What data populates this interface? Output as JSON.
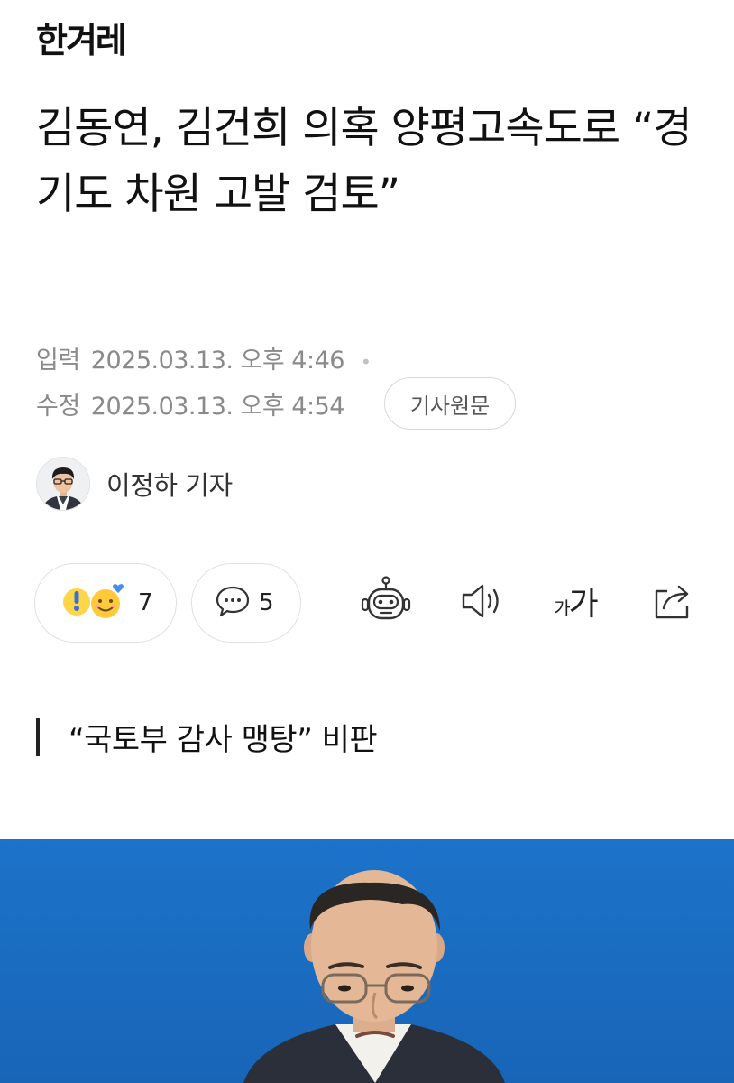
{
  "header": {
    "logo": "한겨레"
  },
  "article": {
    "title": "김동연, 김건희 의혹 양평고속도로 “경기도 차원 고발 검토”",
    "published_label": "입력",
    "published_at": "2025.03.13. 오후 4:46",
    "updated_label": "수정",
    "updated_at": "2025.03.13. 오후 4:54",
    "original_button": "기사원문",
    "reporter": "이정하 기자",
    "subheading": "“국토부 감사 맹탕” 비판"
  },
  "actions": {
    "reaction_count": "7",
    "comment_count": "5",
    "font_size_label_small": "가",
    "font_size_label_large": "가",
    "icons": [
      "thumbs-reaction-icon",
      "comment-icon",
      "ai-summary-robot-icon",
      "text-to-speech-icon",
      "font-size-icon",
      "share-icon"
    ]
  },
  "colors": {
    "photo_background": "#1a6fc4",
    "meta_text": "#8a8a8a",
    "accent_yellow": "#ffc93c"
  }
}
